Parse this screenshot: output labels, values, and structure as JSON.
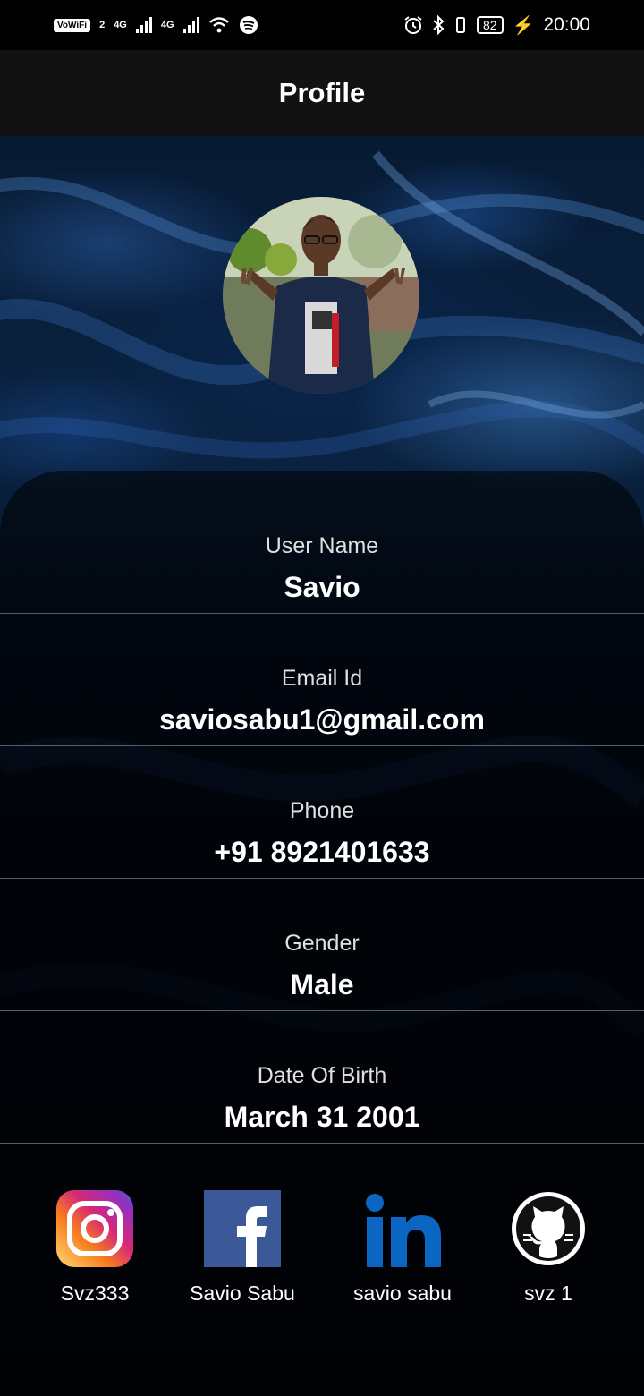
{
  "status_bar": {
    "left_badge": "VoWiFi",
    "sim_index": "2",
    "network1": "4G",
    "network2": "4G",
    "battery": "82",
    "time": "20:00"
  },
  "app_bar": {
    "title": "Profile"
  },
  "profile": {
    "fields": [
      {
        "label": "User Name",
        "value": "Savio"
      },
      {
        "label": "Email Id",
        "value": "saviosabu1@gmail.com"
      },
      {
        "label": "Phone",
        "value": "+91 8921401633"
      },
      {
        "label": "Gender",
        "value": "Male"
      },
      {
        "label": "Date Of Birth",
        "value": "March 31 2001"
      }
    ]
  },
  "socials": [
    {
      "icon": "instagram-icon",
      "name": "Svz333"
    },
    {
      "icon": "facebook-icon",
      "name": "Savio Sabu"
    },
    {
      "icon": "linkedin-icon",
      "name": "savio sabu"
    },
    {
      "icon": "github-icon",
      "name": "svz 1"
    }
  ],
  "colors": {
    "app_bar": "#121212",
    "facebook": "#3b5998",
    "linkedin": "#0a66c2",
    "divider": "#5a5f66"
  }
}
